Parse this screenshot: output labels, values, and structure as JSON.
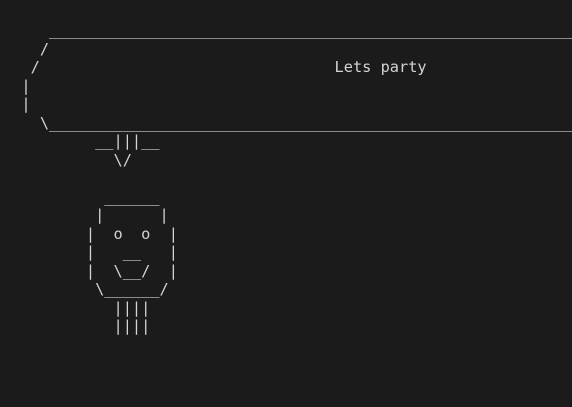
{
  "terminal": {
    "output": "     ___________________________________________________________________\n    /                                                                   \\\n   /                                Lets party                           \\\n  |                                                                       |\n  |                                                                       |\n    \\_____________________________________________________________________/\n          __|||__\n            \\/\n\n           ______\n          |      |\n         |  o  o  |\n         |   __   |\n         |  \\__/  |\n          \\______/\n            ||||\n            ||||"
  }
}
